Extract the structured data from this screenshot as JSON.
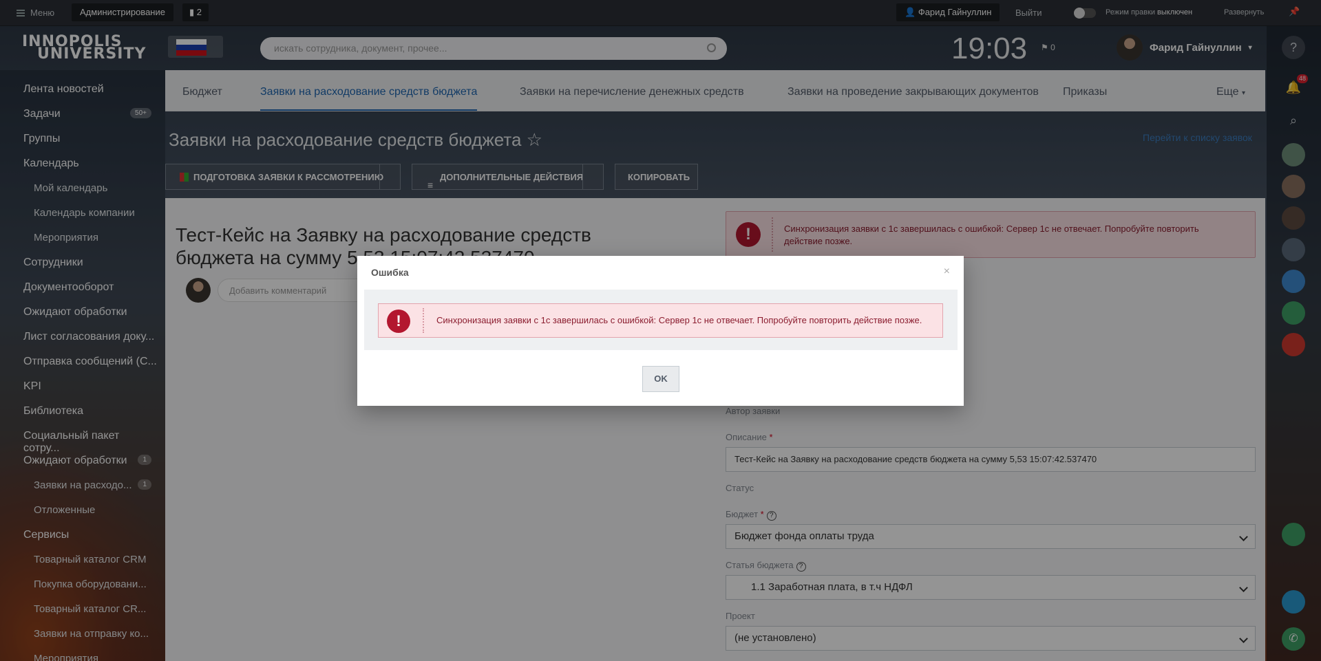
{
  "topbar": {
    "menu": "Меню",
    "admin": "Администрирование",
    "tasks_count": "2",
    "user": "Фарид Гайнуллин",
    "logout": "Выйти",
    "edit_mode_label": "Режим правки",
    "edit_mode_state": "выключен",
    "expand": "Развернуть"
  },
  "header": {
    "logo_line1": "INNOPOLIS",
    "logo_line2": "UNIVERSITY",
    "search_placeholder": "искать сотрудника, документ, прочее...",
    "clock": "19:03",
    "flag_count": "0",
    "user": "Фарид Гайнуллин"
  },
  "sidebar": [
    {
      "label": "Лента новостей",
      "sub": false
    },
    {
      "label": "Задачи",
      "sub": false,
      "badge": "50+"
    },
    {
      "label": "Группы",
      "sub": false
    },
    {
      "label": "Календарь",
      "sub": false
    },
    {
      "label": "Мой календарь",
      "sub": true
    },
    {
      "label": "Календарь компании",
      "sub": true
    },
    {
      "label": "Мероприятия",
      "sub": true
    },
    {
      "label": "Сотрудники",
      "sub": false
    },
    {
      "label": "Документооборот",
      "sub": false
    },
    {
      "label": "Ожидают обработки",
      "sub": false
    },
    {
      "label": "Лист согласования доку...",
      "sub": false
    },
    {
      "label": "Отправка сообщений (С...",
      "sub": false
    },
    {
      "label": "KPI",
      "sub": false
    },
    {
      "label": "Библиотека",
      "sub": false
    },
    {
      "label": "Социальный пакет сотру...",
      "sub": false
    },
    {
      "label": "Ожидают обработки",
      "sub": false,
      "badge": "1"
    },
    {
      "label": "Заявки на расходо...",
      "sub": true,
      "badge": "1"
    },
    {
      "label": "Отложенные",
      "sub": true
    },
    {
      "label": "Сервисы",
      "sub": false
    },
    {
      "label": "Товарный каталог CRM",
      "sub": true
    },
    {
      "label": "Покупка оборудовани...",
      "sub": true
    },
    {
      "label": "Товарный каталог CR...",
      "sub": true
    },
    {
      "label": "Заявки на отправку ко...",
      "sub": true
    },
    {
      "label": "Мероприятия",
      "sub": true
    }
  ],
  "tabs": [
    "Бюджет",
    "Заявки на расходование средств бюджета",
    "Заявки на перечисление денежных средств",
    "Заявки на проведение закрывающих документов",
    "Приказы",
    "Еще"
  ],
  "page": {
    "title": "Заявки на расходование средств бюджета",
    "star": "☆",
    "list_link": "Перейти к списку заявок",
    "btn_prepare": "Подготовка заявки к рассмотрению",
    "btn_actions": "Дополнительные действия",
    "btn_copy": "Копировать"
  },
  "doc": {
    "title": "Тест-Кейс на Заявку на расходование средств бюджета на сумму 5,53 15:07:42.537470",
    "comment_placeholder": "Добавить комментарий"
  },
  "form": {
    "error": "Синхронизация заявки с 1с завершилась с ошибкой: Сервер 1с не отвечает. Попробуйте повторить действие позже.",
    "author_label": "Автор заявки",
    "desc_label": "Описание",
    "desc_value": "Тест-Кейс на Заявку на расходование средств бюджета на сумму 5,53 15:07:42.537470",
    "status_label": "Статус",
    "budget_label": "Бюджет",
    "budget_value": "Бюджет фонда оплаты труда",
    "article_label": "Статья бюджета",
    "article_value": "1.1  Заработная плата, в т.ч  НДФЛ",
    "project_label": "Проект",
    "project_value": "(не установлено)",
    "required": "*",
    "help": "?"
  },
  "rpanel": {
    "notif_count": "48"
  },
  "modal": {
    "title": "Ошибка",
    "close": "×",
    "message": "Синхронизация заявки с 1с завершилась с ошибкой: Сервер 1с не отвечает. Попробуйте повторить действие позже.",
    "ok": "OK",
    "icon": "!"
  },
  "colors": {
    "accent": "#2067b0",
    "error": "#b3172f"
  }
}
